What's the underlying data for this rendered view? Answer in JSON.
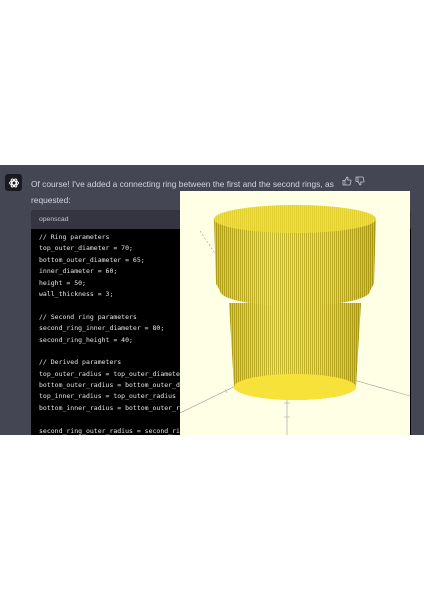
{
  "message": {
    "line1": "Of course! I've added a connecting ring between the first and the second rings, as",
    "line2": "requested:"
  },
  "icons": {
    "assistant_avatar": "chatgpt-logo-icon",
    "thumbs_up": "thumbs-up-icon",
    "thumbs_down": "thumbs-down-icon"
  },
  "code_block": {
    "language": "openscad",
    "lines": [
      "// Ring parameters",
      "top_outer_diameter = 70;",
      "bottom_outer_diameter = 65;",
      "inner_diameter = 60;",
      "height = 50;",
      "wall_thickness = 3;",
      "",
      "// Second ring parameters",
      "second_ring_inner_diameter = 80;",
      "second_ring_height = 40;",
      "",
      "// Derived parameters",
      "top_outer_radius = top_outer_diameter /",
      "bottom_outer_radius = bottom_outer_diame",
      "top_inner_radius = top_outer_radius - w",
      "bottom_inner_radius = bottom_outer_radiu",
      "",
      "second_ring_outer_radius = second_ring_"
    ]
  },
  "viewer": {
    "background_color": "#ffffe5",
    "model_color": "#f0dc32"
  }
}
